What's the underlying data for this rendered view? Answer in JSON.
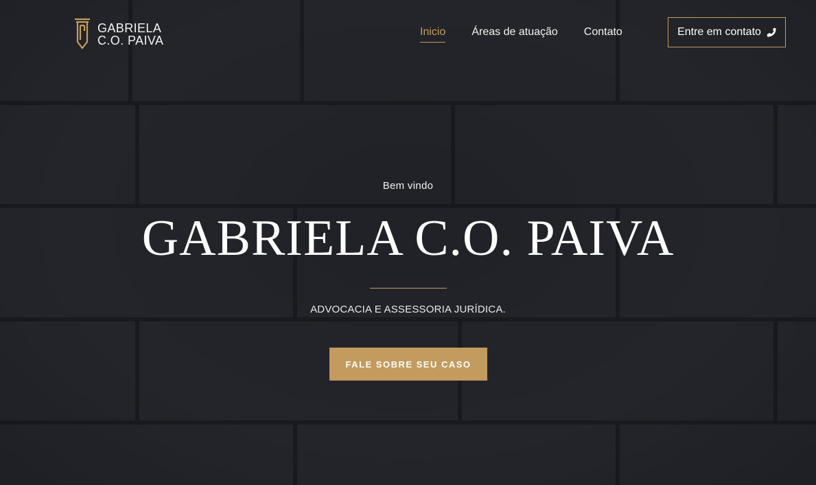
{
  "brand": {
    "line1": "GABRIELA",
    "line2": "C.O. PAIVA",
    "logo_icon": "column-pillar-logo-icon"
  },
  "nav": {
    "items": [
      {
        "label": "Inicio",
        "active": true
      },
      {
        "label": "Áreas de atuação",
        "active": false
      },
      {
        "label": "Contato",
        "active": false
      }
    ],
    "contact_button": "Entre em contato",
    "contact_icon": "phone-icon"
  },
  "hero": {
    "welcome": "Bem vindo",
    "title": "GABRIELA C.O. PAIVA",
    "subtitle": "ADVOCACIA E ASSESSORIA JURÍDICA.",
    "cta": "FALE SOBRE SEU CASO"
  },
  "colors": {
    "accent": "#c59d62",
    "background": "#23252b",
    "text": "#ffffff"
  }
}
